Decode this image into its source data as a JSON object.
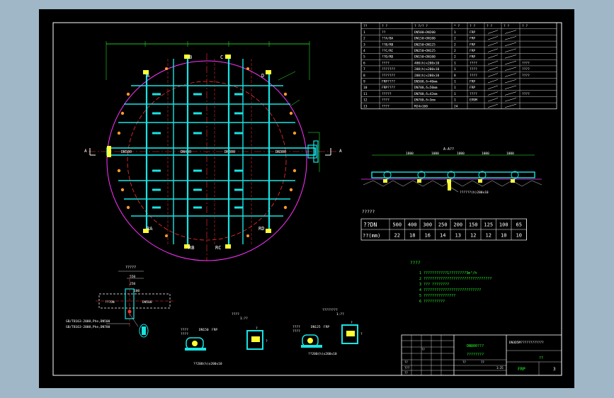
{
  "parts_table": {
    "headers": [
      "??",
      "?  ?",
      "? ?/? ?",
      "* ?",
      "? ?",
      "? ?",
      "? ?",
      "? ?"
    ],
    "rows": [
      [
        "1",
        "??",
        "DN500~DN200",
        "1",
        "FRP",
        "",
        "",
        ""
      ],
      [
        "2",
        "??A/BA",
        "DN150~DN100",
        "2",
        "FRP",
        "",
        "",
        ""
      ],
      [
        "3",
        "??B/RB",
        "DN250~DN125",
        "2",
        "FRP",
        "",
        "",
        ""
      ],
      [
        "4",
        "??C/RC",
        "DN250~DN125",
        "2",
        "FRP",
        "",
        "",
        ""
      ],
      [
        "5",
        "??D/RD",
        "DN150~DN100",
        "2",
        "FRP",
        "",
        "",
        ""
      ],
      [
        "6",
        "????",
        "400(h)x200x10",
        "1",
        "????",
        "",
        "",
        "????"
      ],
      [
        "7",
        "???????",
        "200(h)x200x10",
        "1",
        "????",
        "",
        "",
        "????"
      ],
      [
        "8",
        "???????",
        "200(h)x200x10",
        "8",
        "????",
        "",
        "",
        "????"
      ],
      [
        "9",
        "FRP????",
        "DN500,δ=40mm",
        "1",
        "FRP",
        "",
        "",
        ""
      ],
      [
        "10",
        "FRP????",
        "DN700,δ=50mm",
        "1",
        "FRP",
        "",
        "",
        ""
      ],
      [
        "11",
        "?????",
        "DN700,δ=42mm",
        "1",
        "????",
        "",
        "",
        "????"
      ],
      [
        "12",
        "????",
        "DN700,δ=3mm",
        "1",
        "EPDM",
        "",
        "",
        ""
      ],
      [
        "13",
        "????",
        "M24x160",
        "24",
        "",
        "",
        "",
        ""
      ]
    ]
  },
  "thickness_table": {
    "title": "?????",
    "row1_label": "??DN",
    "row2_label": "??(mm)",
    "dn": [
      "500",
      "400",
      "300",
      "250",
      "200",
      "150",
      "125",
      "100",
      "65"
    ],
    "thickness": [
      "22",
      "18",
      "16",
      "14",
      "13",
      "12",
      "12",
      "10",
      "10"
    ]
  },
  "notes": {
    "title": "????",
    "lines": [
      "1 ???????????1????????3m³/h",
      "2 ????????????????????????????????",
      "3 ??? ????????",
      "4 ???????????????????????????",
      "5 ???????????????",
      "6 ??????????"
    ]
  },
  "plan": {
    "branch_labels": [
      "A",
      "B",
      "C",
      "D",
      "RA",
      "RB",
      "RC",
      "RD"
    ],
    "pipe_labels": [
      "DN500",
      "DN400",
      "DN300",
      "DN300"
    ],
    "section_mark": "A"
  },
  "section": {
    "title": "A-A??",
    "dim_labels": [
      "1800",
      "1000",
      "1000",
      "1000",
      "1000"
    ],
    "callout": "??????(h)200x10"
  },
  "detail_branch": {
    "title": "?????",
    "dims": [
      "550",
      "250",
      "100"
    ],
    "labels": [
      "???DN",
      "DN500"
    ],
    "notes": [
      "GB/T8163-2008,Phe,DN500",
      "GB/T8163-2008,Phe,DN700"
    ]
  },
  "details": [
    {
      "title": "???????",
      "scale": "??? ?",
      "labels": [
        "????",
        "DN150",
        "FRP",
        "????"
      ],
      "callout": "??200(h)x200x10"
    },
    {
      "title": "????",
      "scale": "1:??",
      "labels": [
        "?",
        "?"
      ],
      "callout": ""
    },
    {
      "title": "????",
      "scale": "",
      "labels": [
        "????",
        "DN125",
        "FRP",
        "????"
      ],
      "callout": "??200(h)x200x10"
    },
    {
      "title": "????????",
      "scale": "1:??",
      "labels": [
        "?",
        "?"
      ],
      "callout": ""
    }
  ],
  "title_block": {
    "drawing_no": "DN800???",
    "subtitle": "????????",
    "company": "DN3D5M????????????",
    "name": "??",
    "material": "FRP",
    "sheet": "3",
    "row_labels": [
      "??",
      "???",
      "??",
      "??",
      "??",
      "??"
    ],
    "scale": "1:25"
  },
  "colors": {
    "background": "#000000",
    "border": "#ffffff",
    "pipe": "#18e4e4",
    "centerline": "#ff3030",
    "shell": "#ff33ff",
    "dimension": "#2bff2b",
    "label": "#ffffff",
    "flange": "#ffff33"
  }
}
